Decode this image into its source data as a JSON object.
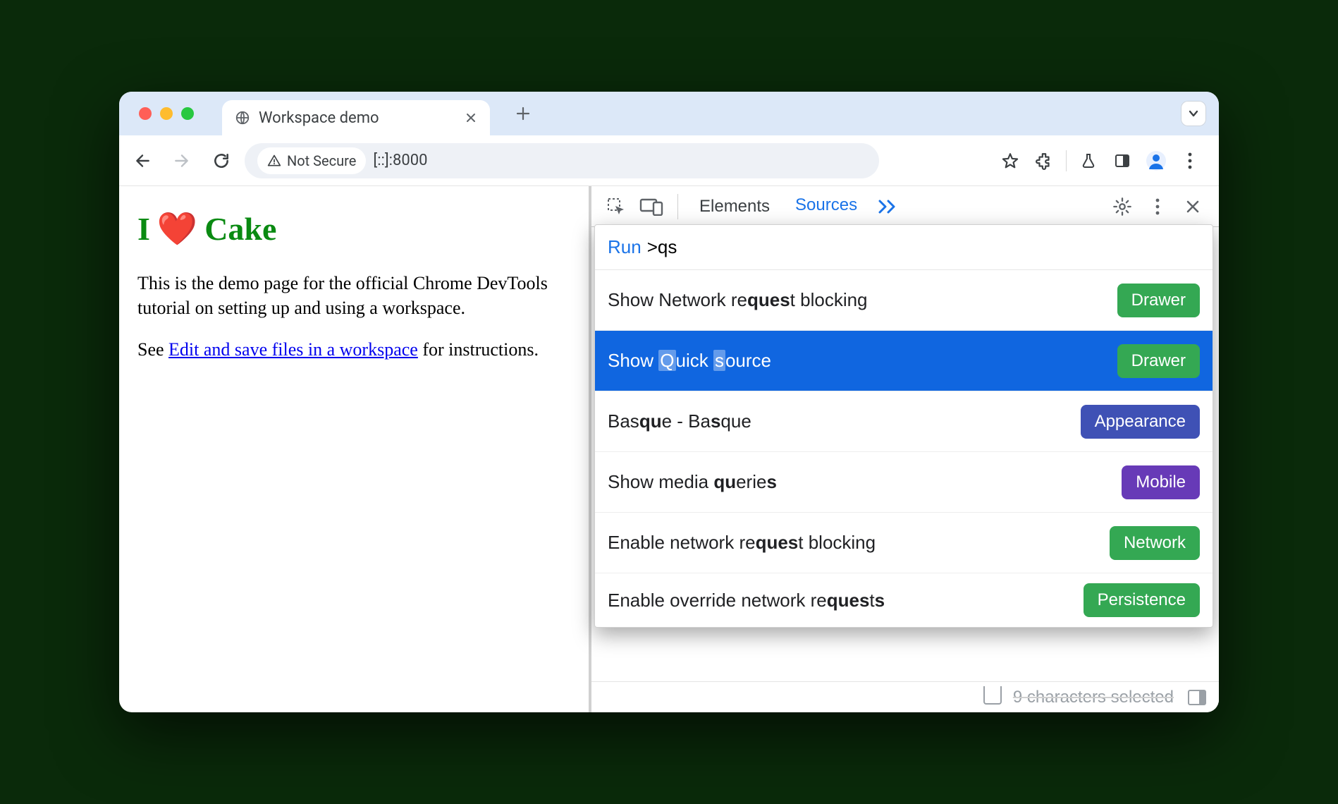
{
  "tab": {
    "title": "Workspace demo"
  },
  "omnibox": {
    "security": "Not Secure",
    "url": "[::]:8000"
  },
  "page": {
    "heading_prefix": "I",
    "heading_suffix": "Cake",
    "p1": "This is the demo page for the official Chrome DevTools tutorial on setting up and using a workspace.",
    "p2_before": "See ",
    "p2_link": "Edit and save files in a workspace",
    "p2_after": " for instructions."
  },
  "devtools": {
    "tabs": {
      "elements": "Elements",
      "sources": "Sources"
    },
    "cmd": {
      "run_label": "Run",
      "query": ">qs",
      "items": [
        {
          "pre": "Show Network re",
          "b1": "que",
          "mid1": "",
          "b2": "s",
          "mid2": "t blocking",
          "pill": "Drawer",
          "pillClass": "green",
          "selected": false
        },
        {
          "pre": "Show ",
          "hl1": "Q",
          "mid1": "uick ",
          "hl2": "s",
          "mid2": "ource",
          "pill": "Drawer",
          "pillClass": "green",
          "selected": true
        },
        {
          "pre": "Bas",
          "b1": "qu",
          "mid1": "e - Ba",
          "b2": "s",
          "mid2": "que",
          "pill": "Appearance",
          "pillClass": "indigo",
          "selected": false
        },
        {
          "pre": "Show media ",
          "b1": "qu",
          "mid1": "erie",
          "b2": "s",
          "mid2": "",
          "pill": "Mobile",
          "pillClass": "purple",
          "selected": false
        },
        {
          "pre": "Enable network re",
          "b1": "que",
          "mid1": "",
          "b2": "s",
          "mid2": "t blocking",
          "pill": "Network",
          "pillClass": "green",
          "selected": false
        },
        {
          "pre": "Enable override network re",
          "b1": "que",
          "mid1": "",
          "b2": "s",
          "mid2": "t",
          "b3": "s",
          "mid3": "",
          "pill": "Persistence",
          "pillClass": "green",
          "selected": false
        }
      ]
    },
    "footer": "9 characters selected"
  }
}
